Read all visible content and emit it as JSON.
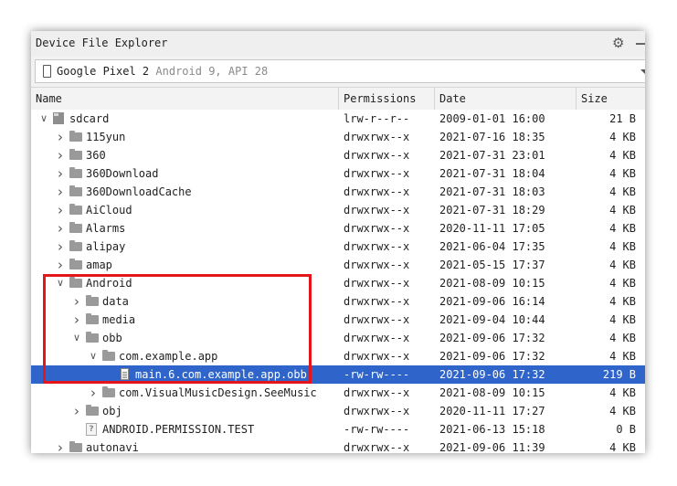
{
  "panel": {
    "title": "Device File Explorer",
    "gear_icon": "gear-icon",
    "device": {
      "name": "Google Pixel 2",
      "api": "Android 9, API 28"
    }
  },
  "columns": {
    "name": "Name",
    "permissions": "Permissions",
    "date": "Date",
    "size": "Size"
  },
  "rows": [
    {
      "name": "sdcard",
      "level": 0,
      "expanded": true,
      "icon": "sdcard-icon",
      "permissions": "lrw-r--r--",
      "date": "2009-01-01 16:00",
      "size": "21 B"
    },
    {
      "name": "115yun",
      "level": 1,
      "expanded": false,
      "icon": "folder-icon",
      "permissions": "drwxrwx--x",
      "date": "2021-07-16 18:35",
      "size": "4 KB"
    },
    {
      "name": "360",
      "level": 1,
      "expanded": false,
      "icon": "folder-icon",
      "permissions": "drwxrwx--x",
      "date": "2021-07-31 23:01",
      "size": "4 KB"
    },
    {
      "name": "360Download",
      "level": 1,
      "expanded": false,
      "icon": "folder-icon",
      "permissions": "drwxrwx--x",
      "date": "2021-07-31 18:04",
      "size": "4 KB"
    },
    {
      "name": "360DownloadCache",
      "level": 1,
      "expanded": false,
      "icon": "folder-icon",
      "permissions": "drwxrwx--x",
      "date": "2021-07-31 18:03",
      "size": "4 KB"
    },
    {
      "name": "AiCloud",
      "level": 1,
      "expanded": false,
      "icon": "folder-icon",
      "permissions": "drwxrwx--x",
      "date": "2021-07-31 18:29",
      "size": "4 KB"
    },
    {
      "name": "Alarms",
      "level": 1,
      "expanded": false,
      "icon": "folder-icon",
      "permissions": "drwxrwx--x",
      "date": "2020-11-11 17:05",
      "size": "4 KB"
    },
    {
      "name": "alipay",
      "level": 1,
      "expanded": false,
      "icon": "folder-icon",
      "permissions": "drwxrwx--x",
      "date": "2021-06-04 17:35",
      "size": "4 KB"
    },
    {
      "name": "amap",
      "level": 1,
      "expanded": false,
      "icon": "folder-icon",
      "permissions": "drwxrwx--x",
      "date": "2021-05-15 17:37",
      "size": "4 KB"
    },
    {
      "name": "Android",
      "level": 1,
      "expanded": true,
      "icon": "folder-icon",
      "permissions": "drwxrwx--x",
      "date": "2021-08-09 10:15",
      "size": "4 KB"
    },
    {
      "name": "data",
      "level": 2,
      "expanded": false,
      "icon": "folder-icon",
      "permissions": "drwxrwx--x",
      "date": "2021-09-06 16:14",
      "size": "4 KB"
    },
    {
      "name": "media",
      "level": 2,
      "expanded": false,
      "icon": "folder-icon",
      "permissions": "drwxrwx--x",
      "date": "2021-09-04 10:44",
      "size": "4 KB"
    },
    {
      "name": "obb",
      "level": 2,
      "expanded": true,
      "icon": "folder-icon",
      "permissions": "drwxrwx--x",
      "date": "2021-09-06 17:32",
      "size": "4 KB"
    },
    {
      "name": "com.example.app",
      "level": 3,
      "expanded": true,
      "icon": "folder-icon",
      "permissions": "drwxrwx--x",
      "date": "2021-09-06 17:32",
      "size": "4 KB"
    },
    {
      "name": "main.6.com.example.app.obb",
      "level": 4,
      "expanded": null,
      "icon": "file-icon",
      "permissions": "-rw-rw----",
      "date": "2021-09-06 17:32",
      "size": "219 B",
      "selected": true
    },
    {
      "name": "com.VisualMusicDesign.SeeMusic",
      "level": 3,
      "expanded": false,
      "icon": "folder-icon",
      "permissions": "drwxrwx--x",
      "date": "2021-08-09 10:15",
      "size": "4 KB"
    },
    {
      "name": "obj",
      "level": 2,
      "expanded": false,
      "icon": "folder-icon",
      "permissions": "drwxrwx--x",
      "date": "2020-11-11 17:27",
      "size": "4 KB"
    },
    {
      "name": "ANDROID.PERMISSION.TEST",
      "level": 2,
      "expanded": null,
      "icon": "unknown-file-icon",
      "permissions": "-rw-rw----",
      "date": "2021-06-13 15:18",
      "size": "0 B"
    },
    {
      "name": "autonavi",
      "level": 1,
      "expanded": false,
      "icon": "folder-icon",
      "permissions": "drwxrwx--x",
      "date": "2021-09-06 11:39",
      "size": "4 KB"
    }
  ],
  "colors": {
    "selection": "#2f65ca",
    "highlight_box": "#e4161b"
  }
}
